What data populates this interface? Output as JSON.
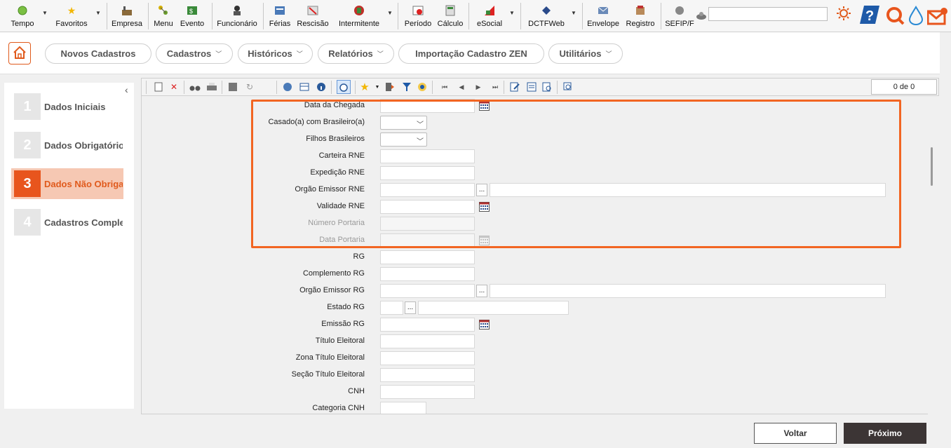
{
  "toolbar": {
    "items": [
      {
        "label": "Tempo",
        "icon": "green-orb-icon"
      },
      {
        "label": "Favoritos",
        "icon": "star-icon"
      },
      {
        "label": "Empresa",
        "icon": "factory-icon"
      },
      {
        "label": "Menu",
        "icon": "menu-tree-icon"
      },
      {
        "label": "Evento",
        "icon": "event-icon"
      },
      {
        "label": "Funcionário",
        "icon": "employee-icon"
      },
      {
        "label": "Férias",
        "icon": "vacation-icon"
      },
      {
        "label": "Rescisão",
        "icon": "termination-icon"
      },
      {
        "label": "Intermitente",
        "icon": "intermittent-icon"
      },
      {
        "label": "Período",
        "icon": "period-icon"
      },
      {
        "label": "Cálculo",
        "icon": "calculator-icon"
      },
      {
        "label": "eSocial",
        "icon": "esocial-icon"
      },
      {
        "label": "DCTFWeb",
        "icon": "dctfweb-icon"
      },
      {
        "label": "Envelope",
        "icon": "envelope-icon"
      },
      {
        "label": "Registro",
        "icon": "register-icon"
      },
      {
        "label": "SEFIP/F",
        "icon": "sefip-icon"
      }
    ]
  },
  "menu": {
    "items": [
      {
        "label": "Novos Cadastros",
        "has_dropdown": false
      },
      {
        "label": "Cadastros",
        "has_dropdown": true
      },
      {
        "label": "Históricos",
        "has_dropdown": true
      },
      {
        "label": "Relatórios",
        "has_dropdown": true
      },
      {
        "label": "Importação Cadastro ZEN",
        "has_dropdown": false
      },
      {
        "label": "Utilitários",
        "has_dropdown": true
      }
    ]
  },
  "wizard": {
    "steps": [
      {
        "number": "1",
        "label": "Dados Iniciais",
        "active": false
      },
      {
        "number": "2",
        "label": "Dados Obrigatório",
        "active": false
      },
      {
        "number": "3",
        "label": "Dados Não Obrigat",
        "active": true
      },
      {
        "number": "4",
        "label": "Cadastros Compler",
        "active": false
      }
    ]
  },
  "record_counter": "0 de 0",
  "form": {
    "fields": [
      {
        "label": "Data da Chegada",
        "type": "date",
        "disabled": false
      },
      {
        "label": "Casado(a) com Brasileiro(a)",
        "type": "select",
        "disabled": false
      },
      {
        "label": "Filhos Brasileiros",
        "type": "select",
        "disabled": false
      },
      {
        "label": "Carteira RNE",
        "type": "text",
        "disabled": false
      },
      {
        "label": "Expedição RNE",
        "type": "text",
        "disabled": false
      },
      {
        "label": "Orgão Emissor RNE",
        "type": "lookup",
        "disabled": false
      },
      {
        "label": "Validade RNE",
        "type": "date",
        "disabled": false
      },
      {
        "label": "Número Portaria",
        "type": "text",
        "disabled": true
      },
      {
        "label": "Data Portaria",
        "type": "date",
        "disabled": true
      },
      {
        "label": "RG",
        "type": "text",
        "disabled": false
      },
      {
        "label": "Complemento RG",
        "type": "text",
        "disabled": false
      },
      {
        "label": "Orgão Emissor RG",
        "type": "lookup",
        "disabled": false
      },
      {
        "label": "Estado RG",
        "type": "lookup-short",
        "disabled": false
      },
      {
        "label": "Emissão RG",
        "type": "date",
        "disabled": false
      },
      {
        "label": "Título Eleitoral",
        "type": "text",
        "disabled": false
      },
      {
        "label": "Zona Título Eleitoral",
        "type": "text",
        "disabled": false
      },
      {
        "label": "Seção Título Eleitoral",
        "type": "text",
        "disabled": false
      },
      {
        "label": "CNH",
        "type": "text",
        "disabled": false
      },
      {
        "label": "Categoria CNH",
        "type": "short",
        "disabled": false
      }
    ],
    "lookup_button_label": "..."
  },
  "buttons": {
    "back": "Voltar",
    "next": "Próximo"
  },
  "colors": {
    "accent": "#e8551d",
    "highlight_border": "#f26522",
    "active_step_bg": "#f6c8b3",
    "primary_button": "#3c3535"
  }
}
